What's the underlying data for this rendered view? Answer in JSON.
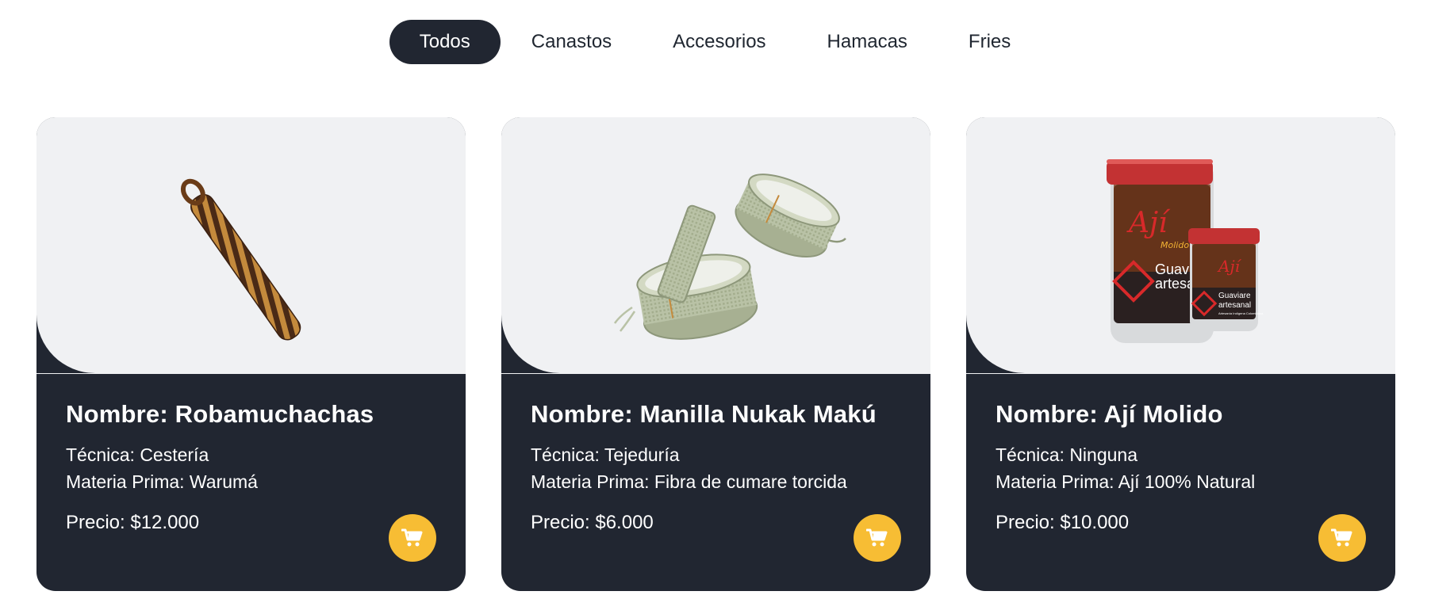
{
  "filters": [
    {
      "label": "Todos",
      "active": true
    },
    {
      "label": "Canastos",
      "active": false
    },
    {
      "label": "Accesorios",
      "active": false
    },
    {
      "label": "Hamacas",
      "active": false
    },
    {
      "label": "Fries",
      "active": false
    }
  ],
  "products": [
    {
      "name": "Nombre: Robamuchachas",
      "technique": "Técnica: Cestería",
      "material": "Materia Prima: Warumá",
      "price": "Precio: $12.000",
      "image_icon": "woven-cylinder-image"
    },
    {
      "name": "Nombre: Manilla Nukak Makú",
      "technique": "Técnica: Tejeduría",
      "material": "Materia Prima: Fibra de cumare torcida",
      "price": "Precio: $6.000",
      "image_icon": "bracelets-image"
    },
    {
      "name": "Nombre: Ají Molido",
      "technique": "Técnica: Ninguna",
      "material": "Materia Prima: Ají 100% Natural",
      "price": "Precio: $10.000",
      "image_icon": "jars-image",
      "label_text": {
        "brand": "Ají",
        "subbrand": "Molido",
        "line1": "Guaviare",
        "line2": "artesanal",
        "line3": "Artesanía Indígena Colombiana"
      }
    }
  ],
  "cart_icon": "shopping-cart-icon",
  "colors": {
    "dark": "#212631",
    "light_panel": "#f0f1f3",
    "accent": "#f7bd34"
  }
}
